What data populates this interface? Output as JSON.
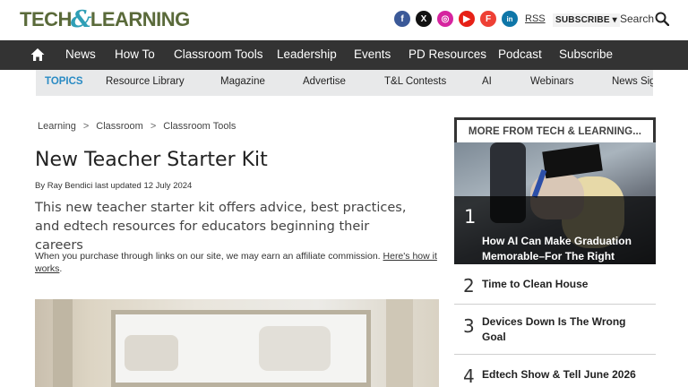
{
  "header": {
    "logo_part1": "TECH",
    "logo_amp": "&",
    "logo_part2": "LEARNING",
    "socials": [
      {
        "name": "facebook",
        "glyph": "f"
      },
      {
        "name": "x",
        "glyph": "X"
      },
      {
        "name": "instagram",
        "glyph": "◎"
      },
      {
        "name": "youtube",
        "glyph": "▶"
      },
      {
        "name": "flipboard",
        "glyph": "F"
      },
      {
        "name": "linkedin",
        "glyph": "in"
      }
    ],
    "rss_label": "RSS",
    "subscribe_label": "SUBSCRIBE ▾",
    "search_label": "Search"
  },
  "nav": {
    "items": [
      "News",
      "How To",
      "Classroom Tools",
      "Leadership",
      "Events",
      "PD Resources",
      "Podcast",
      "Subscribe"
    ]
  },
  "topics": {
    "label": "TOPICS",
    "items": [
      "Resource Library",
      "Magazine",
      "Advertise",
      "T&L Contests",
      "AI",
      "Webinars",
      "News Sig"
    ]
  },
  "article": {
    "breadcrumb": [
      "Learning",
      "Classroom",
      "Classroom Tools"
    ],
    "breadcrumb_sep": ">",
    "title": "New Teacher Starter Kit",
    "byline": "By Ray Bendici last updated 12 July 2024",
    "subtitle": "This new teacher starter kit offers advice, best practices, and edtech resources for educators beginning their careers",
    "affiliate_text": "When you purchase through links on our site, we may earn an affiliate commission.",
    "affiliate_link": "Here's how it works",
    "affiliate_end": "."
  },
  "sidebar": {
    "heading": "MORE FROM TECH & LEARNING...",
    "items": [
      {
        "num": "1",
        "title": "How AI Can Make Graduation Memorable–For The Right Reasons"
      },
      {
        "num": "2",
        "title": "Time to Clean House"
      },
      {
        "num": "3",
        "title": "Devices Down Is The Wrong Goal"
      },
      {
        "num": "4",
        "title": "Edtech Show & Tell June 2026"
      }
    ]
  }
}
